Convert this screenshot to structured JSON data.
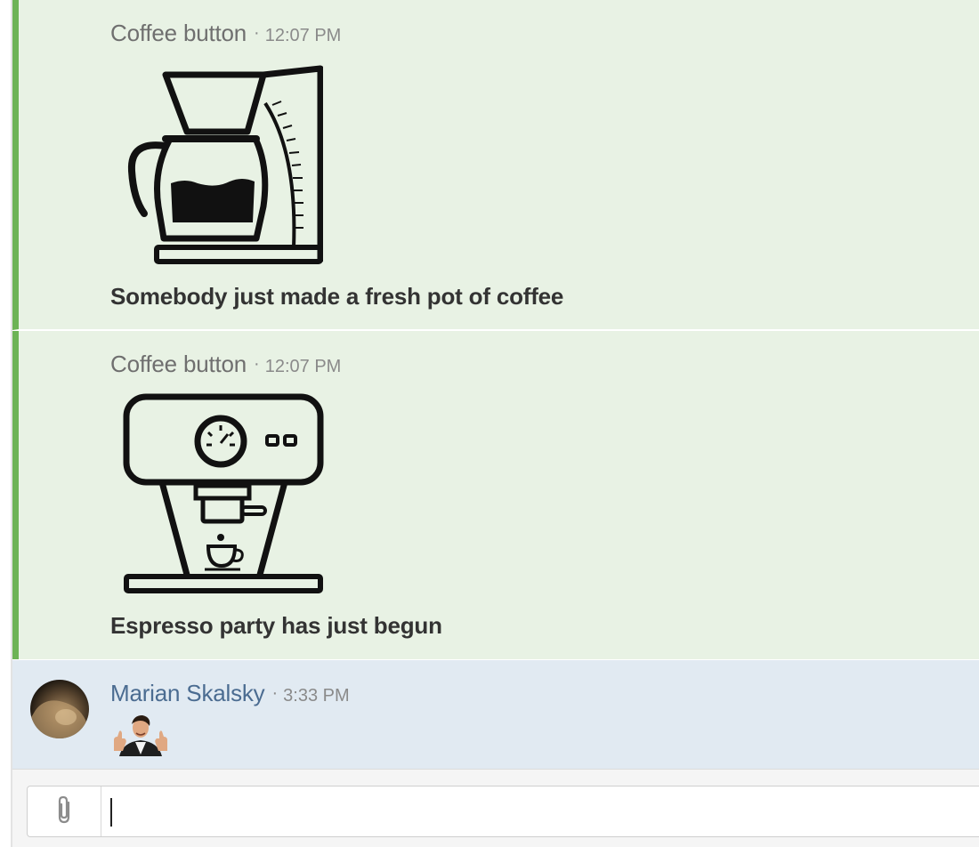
{
  "messages": [
    {
      "sender": "Coffee button",
      "separator": "·",
      "time": "12:07 PM",
      "icon": "coffee-maker-icon",
      "text": "Somebody just made a fresh pot of coffee"
    },
    {
      "sender": "Coffee button",
      "separator": "·",
      "time": "12:07 PM",
      "icon": "espresso-machine-icon",
      "text": "Espresso party has just begun"
    },
    {
      "sender": "Marian Skalsky",
      "separator": "·",
      "time": "3:33 PM",
      "icon": "thumbs-up-person-emoji"
    }
  ],
  "composer": {
    "attach_icon": "paperclip-icon",
    "placeholder": ""
  },
  "colors": {
    "bot_background": "#e8f2e4",
    "bot_accent": "#6db356",
    "user_background": "#e1eaf2",
    "user_name": "#4b6c91"
  }
}
